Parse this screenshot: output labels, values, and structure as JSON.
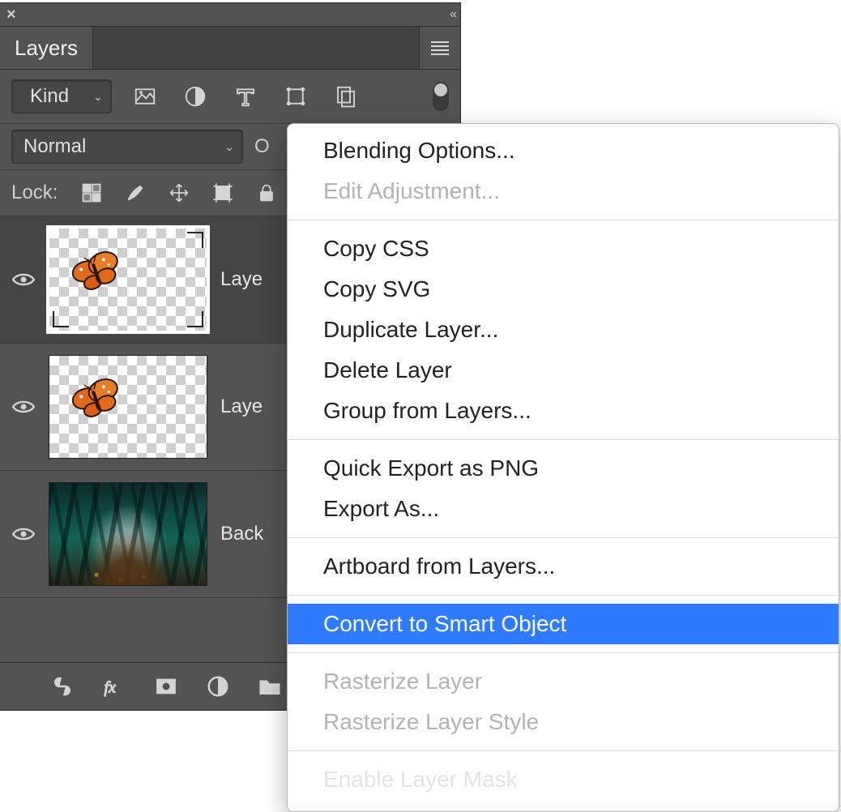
{
  "panel": {
    "title": "Layers",
    "filter": {
      "kind_label": "Kind"
    },
    "blend": {
      "mode": "Normal",
      "opacity_label_prefix": "O"
    },
    "lock": {
      "label": "Lock:"
    },
    "layers": [
      {
        "name": "Laye",
        "visible": true,
        "selected": true,
        "thumb": "butterfly_so"
      },
      {
        "name": "Laye",
        "visible": true,
        "selected": false,
        "thumb": "butterfly"
      },
      {
        "name": "Back",
        "visible": true,
        "selected": false,
        "thumb": "forest"
      }
    ]
  },
  "context_menu": {
    "groups": [
      [
        {
          "label": "Blending Options...",
          "state": "enabled"
        },
        {
          "label": "Edit Adjustment...",
          "state": "disabled"
        }
      ],
      [
        {
          "label": "Copy CSS",
          "state": "enabled"
        },
        {
          "label": "Copy SVG",
          "state": "enabled"
        },
        {
          "label": "Duplicate Layer...",
          "state": "enabled"
        },
        {
          "label": "Delete Layer",
          "state": "enabled"
        },
        {
          "label": "Group from Layers...",
          "state": "enabled"
        }
      ],
      [
        {
          "label": "Quick Export as PNG",
          "state": "enabled"
        },
        {
          "label": "Export As...",
          "state": "enabled"
        }
      ],
      [
        {
          "label": "Artboard from Layers...",
          "state": "enabled"
        }
      ],
      [
        {
          "label": "Convert to Smart Object",
          "state": "highlight"
        }
      ],
      [
        {
          "label": "Rasterize Layer",
          "state": "disabled"
        },
        {
          "label": "Rasterize Layer Style",
          "state": "disabled"
        }
      ],
      [
        {
          "label": "Enable Layer Mask",
          "state": "disabled",
          "faded": true
        }
      ]
    ]
  }
}
